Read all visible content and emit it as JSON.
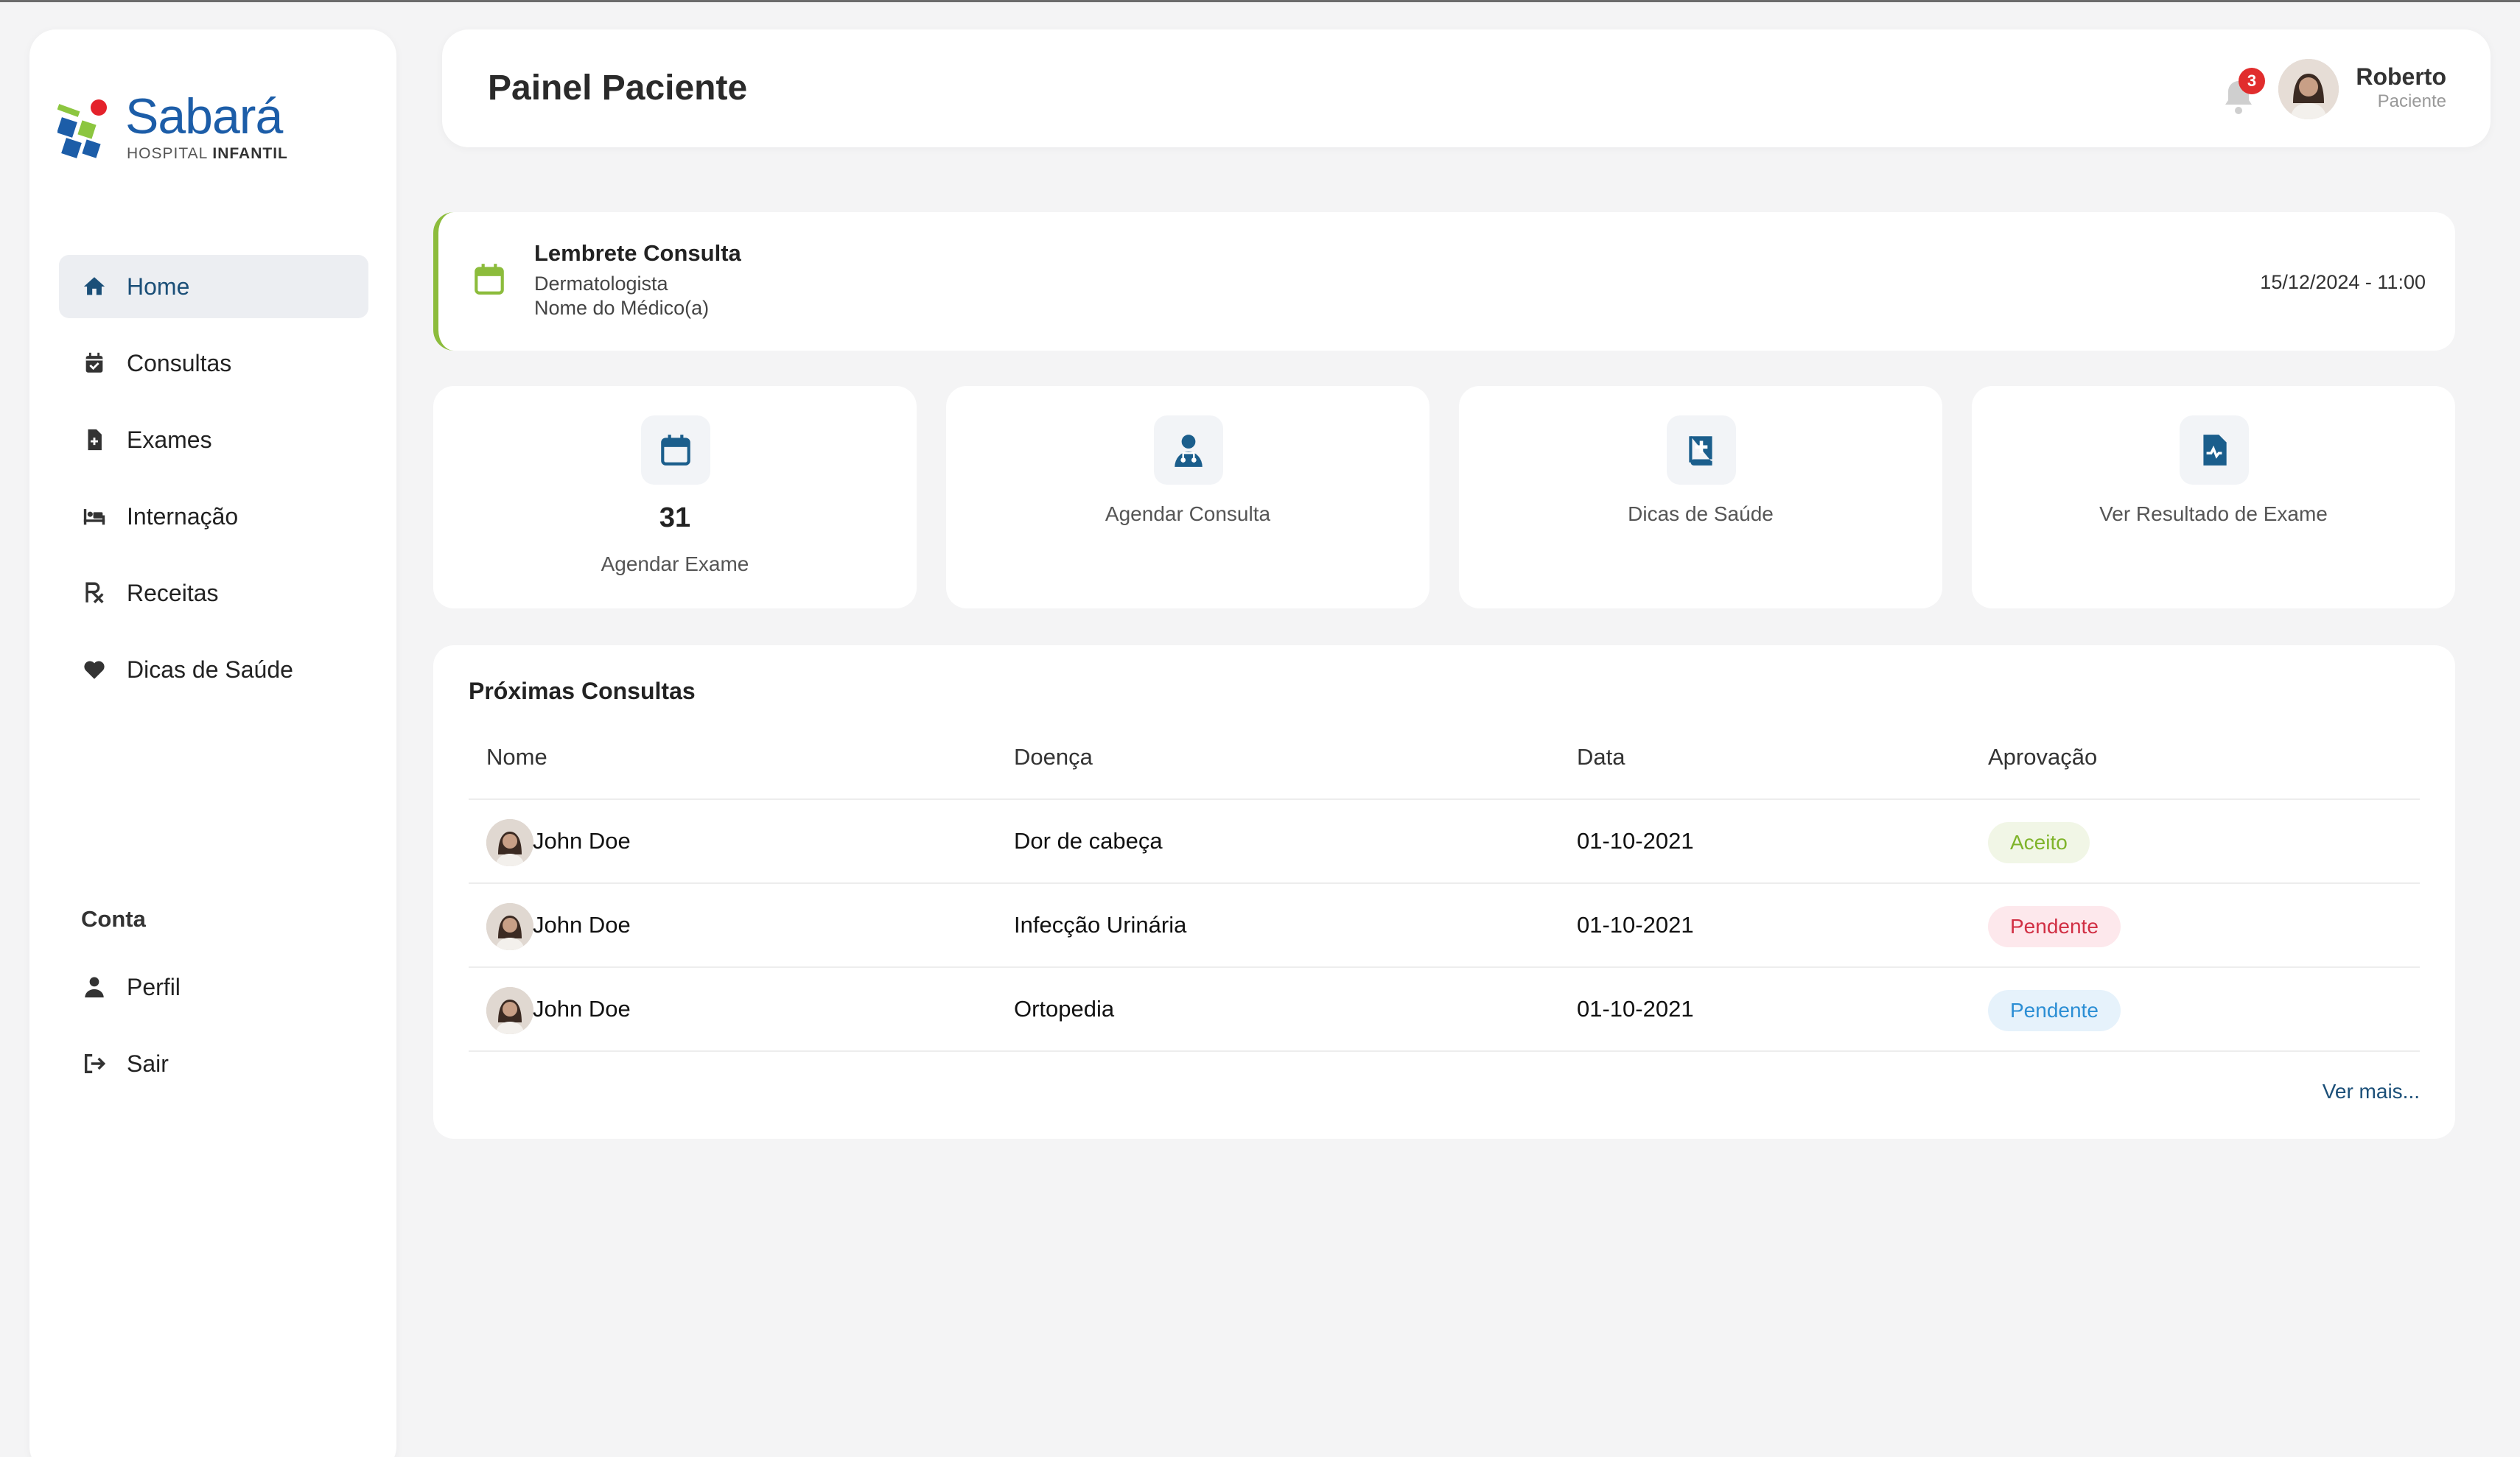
{
  "brand": {
    "name": "Sabará",
    "sub_light": "HOSPITAL",
    "sub_bold": "INFANTIL"
  },
  "sidebar": {
    "items": [
      {
        "label": "Home",
        "icon": "home-icon",
        "active": true
      },
      {
        "label": "Consultas",
        "icon": "calendar-check-icon"
      },
      {
        "label": "Exames",
        "icon": "file-medical-icon"
      },
      {
        "label": "Internação",
        "icon": "bed-icon"
      },
      {
        "label": "Receitas",
        "icon": "prescription-icon"
      },
      {
        "label": "Dicas de Saúde",
        "icon": "heart-icon"
      }
    ],
    "account_title": "Conta",
    "account_items": [
      {
        "label": "Perfil",
        "icon": "user-icon"
      },
      {
        "label": "Sair",
        "icon": "logout-icon"
      }
    ]
  },
  "header": {
    "title": "Painel Paciente",
    "notifications": "3",
    "user_name": "Roberto",
    "user_role": "Paciente"
  },
  "reminder": {
    "title": "Lembrete Consulta",
    "specialty": "Dermatologista",
    "doctor": "Nome do Médico(a)",
    "datetime": "15/12/2024 - 11:00"
  },
  "cards": [
    {
      "count": "31",
      "label": "Agendar Exame",
      "icon": "calendar-icon"
    },
    {
      "label": "Agendar Consulta",
      "icon": "doctor-icon"
    },
    {
      "label": "Dicas de Saúde",
      "icon": "medical-book-icon"
    },
    {
      "label": "Ver Resultado de Exame",
      "icon": "file-pulse-icon"
    }
  ],
  "appointments": {
    "title": "Próximas Consultas",
    "columns": [
      "Nome",
      "Doença",
      "Data",
      "Aprovação"
    ],
    "rows": [
      {
        "name": "John Doe",
        "disease": "Dor de cabeça",
        "date": "01-10-2021",
        "status": "Aceito"
      },
      {
        "name": "John Doe",
        "disease": "Infecção Urinária",
        "date": "01-10-2021",
        "status": "Pendente"
      },
      {
        "name": "John Doe",
        "disease": "Ortopedia",
        "date": "01-10-2021",
        "status": "Pendente"
      }
    ],
    "more": "Ver mais..."
  },
  "colors": {
    "primary": "#1b4f78",
    "accent_green": "#8cbc3c",
    "danger": "#d12f44",
    "info": "#2b8ed4"
  }
}
